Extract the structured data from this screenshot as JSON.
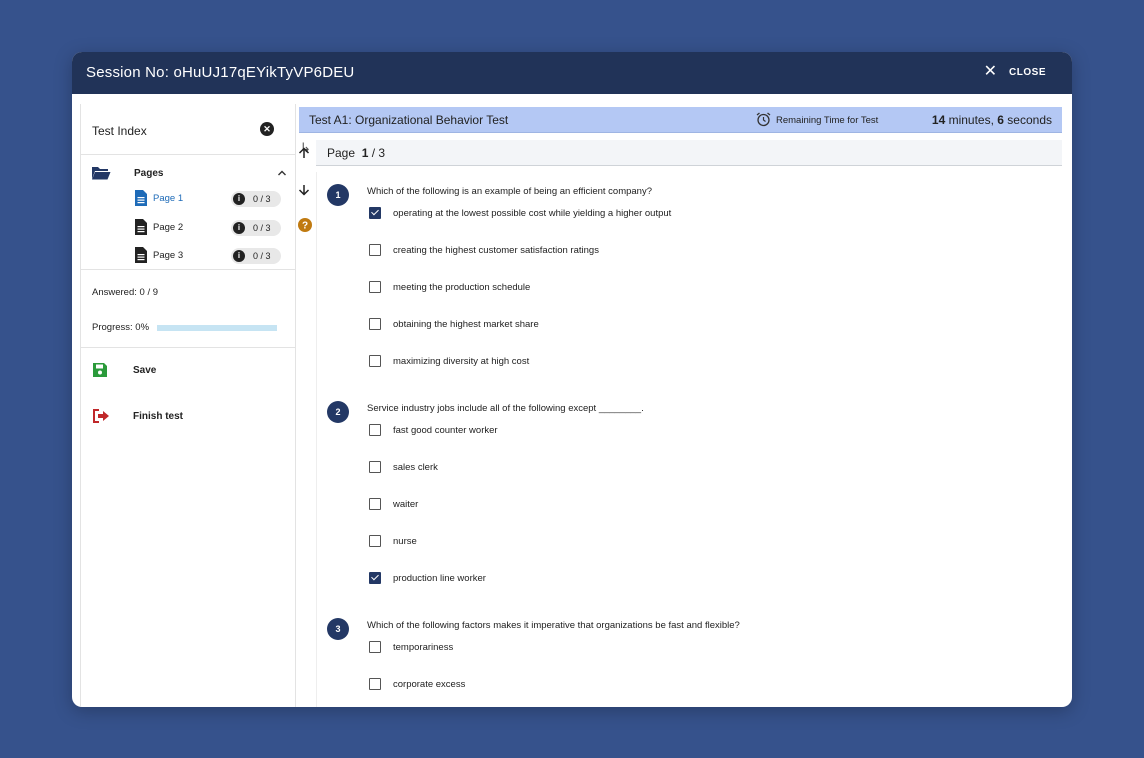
{
  "header": {
    "session_label": "Session No: oHuUJ17qEYikTyVP6DEU",
    "close_label": "CLOSE"
  },
  "sidebar": {
    "title": "Test Index",
    "pages_label": "Pages",
    "pages": [
      {
        "label": "Page 1",
        "count": "0 / 3",
        "active": true
      },
      {
        "label": "Page 2",
        "count": "0 / 3",
        "active": false
      },
      {
        "label": "Page 3",
        "count": "0 / 3",
        "active": false
      }
    ],
    "answered": "Answered: 0 / 9",
    "progress_label": "Progress: 0%",
    "progress_value": 0,
    "save_label": "Save",
    "finish_label": "Finish test"
  },
  "test": {
    "title": "Test A1: Organizational Behavior Test",
    "remaining_label": "Remaining Time for Test",
    "minutes": "14",
    "minutes_unit": " minutes, ",
    "seconds": "6",
    "seconds_unit": " seconds",
    "page_label": "Page",
    "page_current": "1",
    "page_total": " / 3"
  },
  "questions": [
    {
      "number": "1",
      "text": "Which of the following is an example of being an efficient company?",
      "options": [
        {
          "text": "operating at the lowest possible cost while yielding a higher output",
          "checked": true
        },
        {
          "text": "creating the highest customer satisfaction ratings",
          "checked": false
        },
        {
          "text": "meeting the production schedule",
          "checked": false
        },
        {
          "text": "obtaining the highest market share",
          "checked": false
        },
        {
          "text": "maximizing diversity at high cost",
          "checked": false
        }
      ]
    },
    {
      "number": "2",
      "text": "Service industry jobs include all of the following except ________.",
      "options": [
        {
          "text": "fast good counter worker",
          "checked": false
        },
        {
          "text": "sales clerk",
          "checked": false
        },
        {
          "text": "waiter",
          "checked": false
        },
        {
          "text": "nurse",
          "checked": false
        },
        {
          "text": "production line worker",
          "checked": true
        }
      ]
    },
    {
      "number": "3",
      "text": "Which of the following factors makes it imperative that organizations be fast and flexible?",
      "options": [
        {
          "text": "temporariness",
          "checked": false
        },
        {
          "text": "corporate excess",
          "checked": false
        }
      ]
    }
  ],
  "colors": {
    "header": "#213358",
    "accent": "#233865",
    "test_bar": "#b4c8f4",
    "help": "#c07a10",
    "save": "#2a9a3a",
    "finish": "#c0282a"
  }
}
